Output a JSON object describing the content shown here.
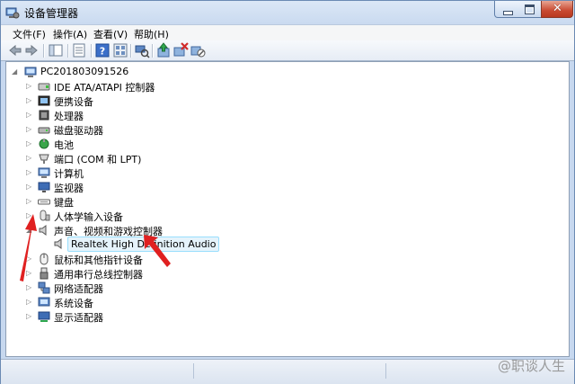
{
  "window": {
    "title": "设备管理器"
  },
  "menu": {
    "file": "文件(F)",
    "action": "操作(A)",
    "view": "查看(V)",
    "help": "帮助(H)"
  },
  "toolbar": {
    "icons": [
      "back-icon",
      "forward-icon",
      "show-hide-tree-icon",
      "properties-icon",
      "help-icon",
      "view-icon",
      "scan-hardware-icon",
      "update-driver-icon",
      "uninstall-icon",
      "disable-icon"
    ]
  },
  "tree": {
    "root": "PC201803091526",
    "categories": [
      "IDE ATA/ATAPI 控制器",
      "便携设备",
      "处理器",
      "磁盘驱动器",
      "电池",
      "端口 (COM 和 LPT)",
      "计算机",
      "监视器",
      "键盘",
      "人体学输入设备",
      "声音、视频和游戏控制器",
      "鼠标和其他指针设备",
      "通用串行总线控制器",
      "网络适配器",
      "系统设备",
      "显示适配器"
    ],
    "child_of_sound": "Realtek High Definition Audio"
  },
  "watermark": "@职谈人生",
  "colors": {
    "selection_border": "#99defd",
    "selection_fill": "#e5f3fb",
    "annotation_red": "#e02020"
  }
}
